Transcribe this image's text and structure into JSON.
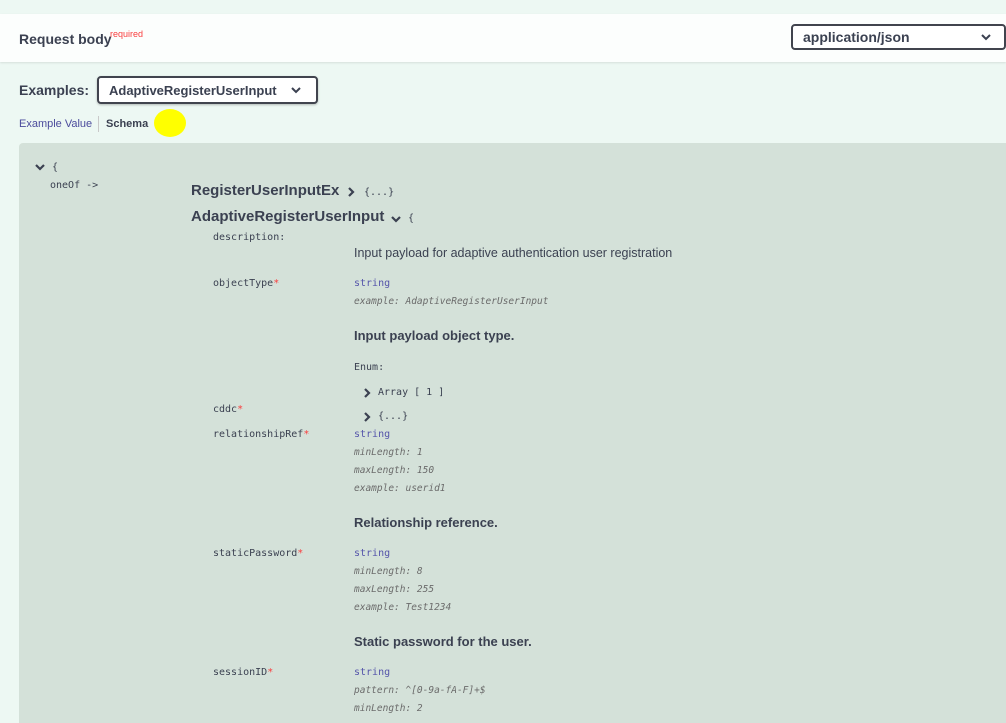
{
  "request_body": {
    "title": "Request body",
    "required_label": "required",
    "content_type": "application/json"
  },
  "examples": {
    "label": "Examples:",
    "selected": "AdaptiveRegisterUserInput"
  },
  "tabs": {
    "example_value": "Example Value",
    "schema": "Schema"
  },
  "schema": {
    "root_brace": "{",
    "oneof_label": "oneOf ->",
    "collapsed_model": {
      "name": "RegisterUserInputEx",
      "summary": "{...}"
    },
    "expanded_model": {
      "name": "AdaptiveRegisterUserInput",
      "brace": "{",
      "description_key": "description:",
      "description_value": "Input payload for adaptive authentication user registration"
    },
    "properties": [
      {
        "name": "objectType",
        "required_mark": "*",
        "type": "string",
        "meta": [
          "example: AdaptiveRegisterUserInput"
        ],
        "description": "Input payload object type.",
        "enum_label": "Enum:",
        "enum_summary": "Array [ 1 ]"
      },
      {
        "name": "cddc",
        "required_mark": "*",
        "summary": "{...}"
      },
      {
        "name": "relationshipRef",
        "required_mark": "*",
        "type": "string",
        "meta": [
          "minLength: 1",
          "maxLength: 150",
          "example: userid1"
        ],
        "description": "Relationship reference."
      },
      {
        "name": "staticPassword",
        "required_mark": "*",
        "type": "string",
        "meta": [
          "minLength: 8",
          "maxLength: 255",
          "example: Test1234"
        ],
        "description": "Static password for the user."
      },
      {
        "name": "sessionID",
        "required_mark": "*",
        "type": "string",
        "meta": [
          "pattern: ^[0-9a-fA-F]+$",
          "minLength: 2"
        ]
      }
    ]
  },
  "icons": {
    "chevron_down": "chevron-down-icon",
    "chevron_right": "chevron-right-icon"
  },
  "colors": {
    "background": "#edf8f3",
    "panel": "#d4e1d9",
    "required": "#f93e3e",
    "link": "#4b4b9c",
    "highlight": "#ffff00"
  }
}
